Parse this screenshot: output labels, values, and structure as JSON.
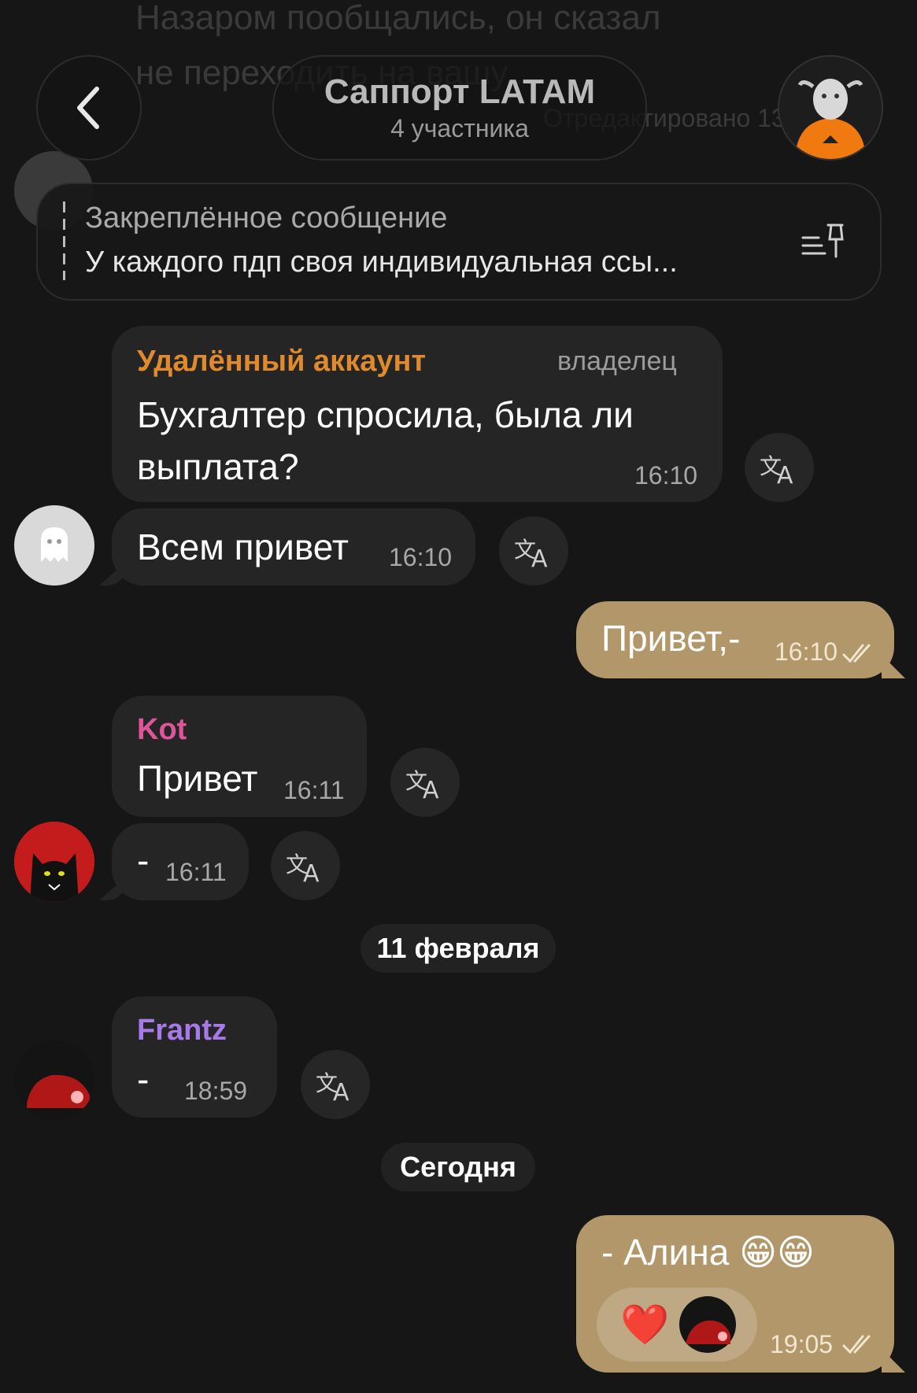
{
  "header": {
    "title": "Саппорт LATAM",
    "subtitle": "4 участника",
    "back_label": "back"
  },
  "background_text": {
    "line1": "Назаром пообщались, он сказал",
    "line2": "не переходить на вашу...",
    "time": "Отредактировано 13:14"
  },
  "pinned": {
    "title": "Закреплённое сообщение",
    "text": "У каждого пдп своя индивидуальная ссы..."
  },
  "messages": [
    {
      "sender": "Удалённый аккаунт",
      "role": "владелец",
      "text1": "Бухгалтер спросила, была ли",
      "text2": "выплата?",
      "time": "16:10"
    },
    {
      "text": "Всем привет",
      "time": "16:10"
    },
    {
      "text": "Привет,-",
      "time": "16:10"
    },
    {
      "sender": "Kot",
      "text": "Привет",
      "time": "16:11"
    },
    {
      "text": "-",
      "time": "16:11"
    },
    {
      "sender": "Frantz",
      "text": "-",
      "time": "18:59"
    },
    {
      "text": "- Алина 😁😁",
      "time": "19:05"
    }
  ],
  "dates": {
    "d1": "11 февраля",
    "d2": "Сегодня"
  },
  "reaction": "❤️",
  "colors": {
    "background": "#161616",
    "bubble_in": "#252525",
    "bubble_out": "#b1976a",
    "sender_deleted": "#e08a2c",
    "sender_kot": "#e0559a",
    "sender_frantz": "#a779e9"
  }
}
